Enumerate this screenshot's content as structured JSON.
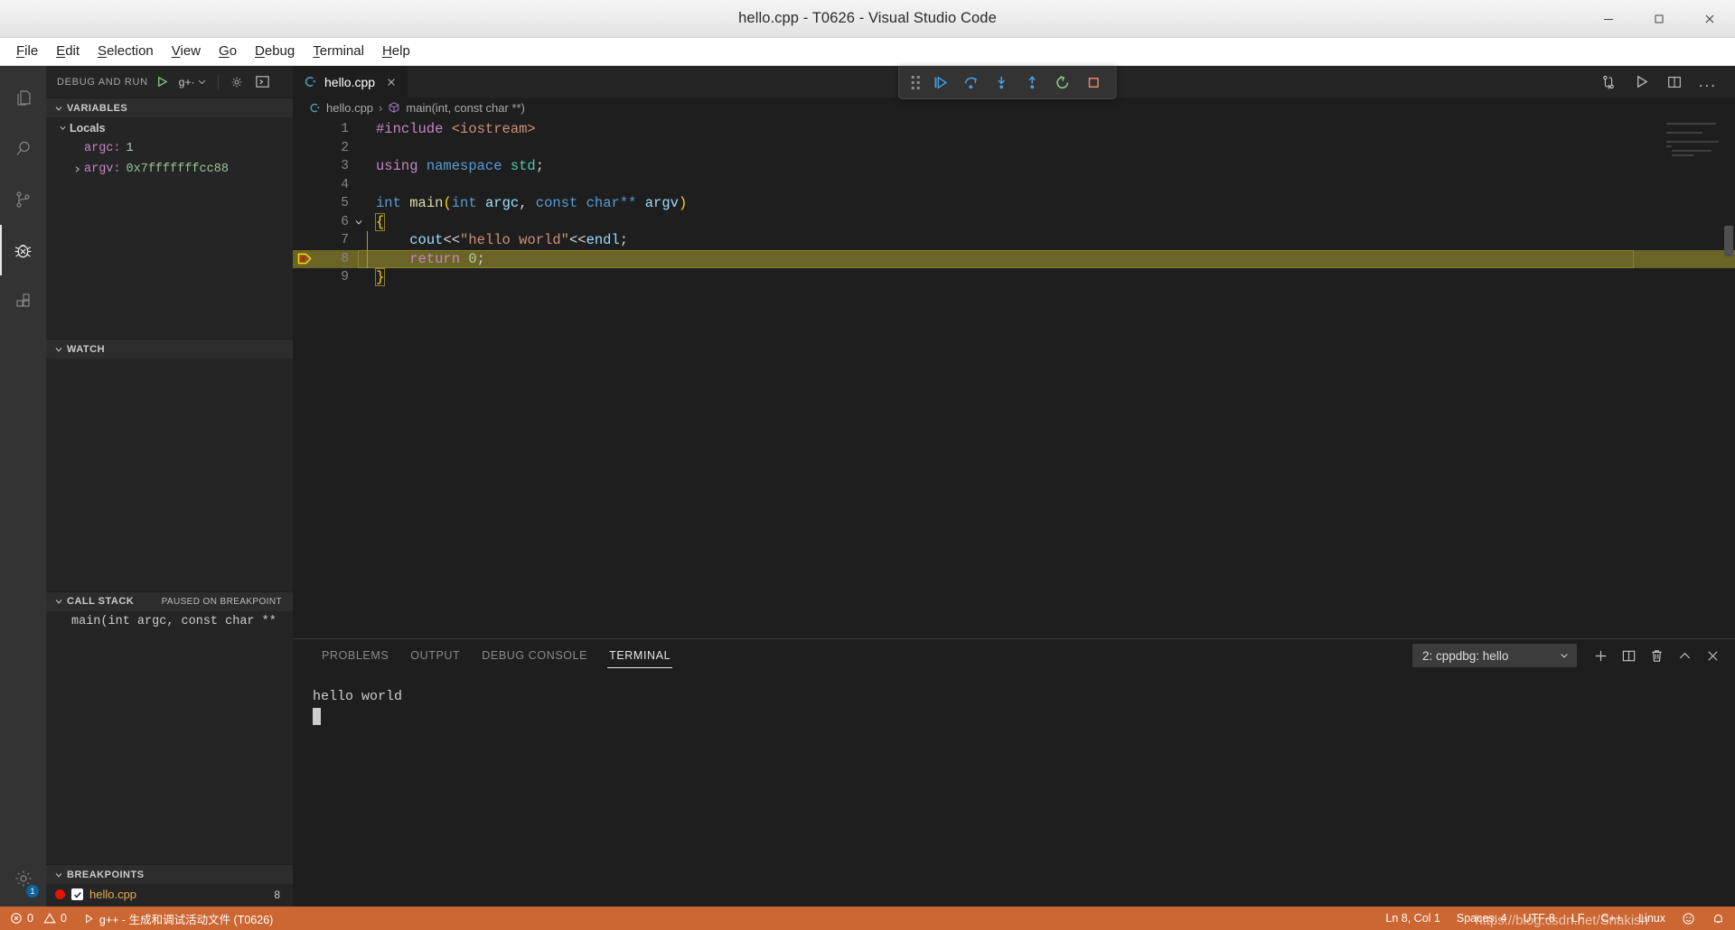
{
  "window": {
    "title": "hello.cpp - T0626 - Visual Studio Code",
    "minimize_label": "minimize-window",
    "maximize_label": "maximize-window",
    "close_label": "close-window"
  },
  "menubar": {
    "items": [
      {
        "label": "File",
        "mnemonic": "F"
      },
      {
        "label": "Edit",
        "mnemonic": "E"
      },
      {
        "label": "Selection",
        "mnemonic": "S"
      },
      {
        "label": "View",
        "mnemonic": "V"
      },
      {
        "label": "Go",
        "mnemonic": "G"
      },
      {
        "label": "Debug",
        "mnemonic": "D"
      },
      {
        "label": "Terminal",
        "mnemonic": "T"
      },
      {
        "label": "Help",
        "mnemonic": "H"
      }
    ]
  },
  "activitybar": {
    "items": [
      {
        "icon": "files-icon",
        "name": "explorer"
      },
      {
        "icon": "search-icon",
        "name": "search"
      },
      {
        "icon": "source-control-icon",
        "name": "source-control"
      },
      {
        "icon": "debug-icon",
        "name": "run-and-debug"
      },
      {
        "icon": "extensions-icon",
        "name": "extensions"
      }
    ],
    "manage": {
      "icon": "gear-icon",
      "badge": "1"
    }
  },
  "sidebar": {
    "title": "DEBUG AND RUN",
    "start_debug_tooltip": "start-debugging",
    "config_name": "g+·",
    "gear_tooltip": "open-launch-json",
    "console_tooltip": "debug-console",
    "sections": {
      "variables": {
        "title": "VARIABLES",
        "scope": "Locals",
        "rows": [
          {
            "name": "argc:",
            "value": "1",
            "expandable": false
          },
          {
            "name": "argv:",
            "value": "0x7fffffffcc88",
            "expandable": true
          }
        ]
      },
      "watch": {
        "title": "WATCH",
        "rows": []
      },
      "callstack": {
        "title": "CALL STACK",
        "status": "PAUSED ON BREAKPOINT",
        "rows": [
          "main(int argc, const char **"
        ]
      },
      "breakpoints": {
        "title": "BREAKPOINTS",
        "rows": [
          {
            "file": "hello.cpp",
            "line": "8",
            "enabled": true
          }
        ]
      }
    }
  },
  "editor": {
    "tab": {
      "label": "hello.cpp",
      "icon": "cpp-file-icon",
      "close": "×"
    },
    "actions": [
      {
        "icon": "compare-changes-icon",
        "name": "open-changes"
      },
      {
        "icon": "run-icon",
        "name": "run-code"
      },
      {
        "icon": "split-editor-icon",
        "name": "split-editor-right"
      },
      {
        "icon": "more-actions-icon",
        "name": "more-actions",
        "label": "..."
      }
    ],
    "breadcrumb": {
      "file": "hello.cpp",
      "separator": "›",
      "symbol": "main(int, const char **)"
    },
    "current_line": 8,
    "breakpoint_line": 8,
    "lines": [
      {
        "n": 1,
        "tokens": [
          {
            "t": "#include ",
            "c": "t-pre"
          },
          {
            "t": "<iostream>",
            "c": "t-str"
          }
        ]
      },
      {
        "n": 2,
        "tokens": []
      },
      {
        "n": 3,
        "tokens": [
          {
            "t": "using ",
            "c": "t-kw2"
          },
          {
            "t": "namespace ",
            "c": "t-kw"
          },
          {
            "t": "std",
            "c": "t-ns"
          },
          {
            "t": ";",
            "c": "t-punc"
          }
        ]
      },
      {
        "n": 4,
        "tokens": []
      },
      {
        "n": 5,
        "tokens": [
          {
            "t": "int ",
            "c": "t-kw"
          },
          {
            "t": "main",
            "c": "t-fn"
          },
          {
            "t": "(",
            "c": "t-brace-y"
          },
          {
            "t": "int ",
            "c": "t-kw"
          },
          {
            "t": "argc",
            "c": "t-var"
          },
          {
            "t": ", ",
            "c": "t-punc"
          },
          {
            "t": "const ",
            "c": "t-kw"
          },
          {
            "t": "char** ",
            "c": "t-kw"
          },
          {
            "t": "argv",
            "c": "t-var"
          },
          {
            "t": ")",
            "c": "t-brace-y"
          }
        ]
      },
      {
        "n": 6,
        "tokens": [
          {
            "t": "{",
            "c": "t-brace-y"
          }
        ],
        "foldable": true
      },
      {
        "n": 7,
        "tokens": [
          {
            "t": "    ",
            "c": "t-punc"
          },
          {
            "t": "cout",
            "c": "t-var"
          },
          {
            "t": "<<",
            "c": "t-punc"
          },
          {
            "t": "\"hello world\"",
            "c": "t-str"
          },
          {
            "t": "<<",
            "c": "t-punc"
          },
          {
            "t": "endl",
            "c": "t-var"
          },
          {
            "t": ";",
            "c": "t-punc"
          }
        ]
      },
      {
        "n": 8,
        "tokens": [
          {
            "t": "    ",
            "c": "t-punc"
          },
          {
            "t": "return ",
            "c": "t-kw2"
          },
          {
            "t": "0",
            "c": "t-num"
          },
          {
            "t": ";",
            "c": "t-punc"
          }
        ]
      },
      {
        "n": 9,
        "tokens": [
          {
            "t": "}",
            "c": "t-brace-y"
          }
        ]
      }
    ]
  },
  "debug_toolbar": {
    "buttons": [
      {
        "name": "drag-handle-icon",
        "tooltip": "drag"
      },
      {
        "name": "continue-icon",
        "tooltip": "Continue",
        "color": "#4a9ee0"
      },
      {
        "name": "step-over-icon",
        "tooltip": "Step Over",
        "color": "#4a9ee0"
      },
      {
        "name": "step-into-icon",
        "tooltip": "Step Into",
        "color": "#4a9ee0"
      },
      {
        "name": "step-out-icon",
        "tooltip": "Step Out",
        "color": "#4a9ee0"
      },
      {
        "name": "restart-icon",
        "tooltip": "Restart",
        "color": "#89d185"
      },
      {
        "name": "stop-icon",
        "tooltip": "Stop",
        "color": "#e8836a"
      }
    ]
  },
  "panel": {
    "tabs": [
      {
        "label": "PROBLEMS",
        "active": false
      },
      {
        "label": "OUTPUT",
        "active": false
      },
      {
        "label": "DEBUG CONSOLE",
        "active": false
      },
      {
        "label": "TERMINAL",
        "active": true
      }
    ],
    "terminal_select": {
      "value": "2: cppdbg: hello",
      "chevron": "⌄"
    },
    "actions": [
      {
        "icon": "plus-icon",
        "name": "new-terminal"
      },
      {
        "icon": "split-terminal-icon",
        "name": "split-terminal"
      },
      {
        "icon": "trash-icon",
        "name": "kill-terminal"
      },
      {
        "icon": "chevron-up-icon",
        "name": "maximize-panel"
      },
      {
        "icon": "close-icon",
        "name": "close-panel"
      }
    ],
    "terminal_output": [
      "hello world"
    ]
  },
  "statusbar": {
    "left": [
      {
        "name": "problems",
        "icon": "error-icon",
        "errors": "0",
        "warn_icon": "warning-icon",
        "warnings": "0"
      },
      {
        "name": "build-task",
        "icon": "play-icon",
        "label": "g++ - 生成和调试活动文件 (T0626)"
      }
    ],
    "right": [
      {
        "name": "cursor-position",
        "label": "Ln 8, Col 1"
      },
      {
        "name": "indentation",
        "label": "Spaces: 4"
      },
      {
        "name": "encoding",
        "label": "UTF-8"
      },
      {
        "name": "eol",
        "label": "LF"
      },
      {
        "name": "language-mode",
        "label": "C++"
      },
      {
        "name": "remote-platform",
        "label": "Linux"
      },
      {
        "name": "feedback-icon",
        "label": "☺"
      },
      {
        "name": "notifications-icon",
        "label": "🔔"
      }
    ]
  },
  "watermark": {
    "text": "https://blog.csdn.net/Snakish"
  },
  "colors": {
    "statusbar_debug": "#cc6633",
    "editor_bg": "#1e1e1e",
    "sidebar_bg": "#252526",
    "activitybar_bg": "#333333",
    "current_line_highlight": "#6b6427",
    "breakpoint_red": "#e51400",
    "accent_blue": "#4a9ee0"
  }
}
